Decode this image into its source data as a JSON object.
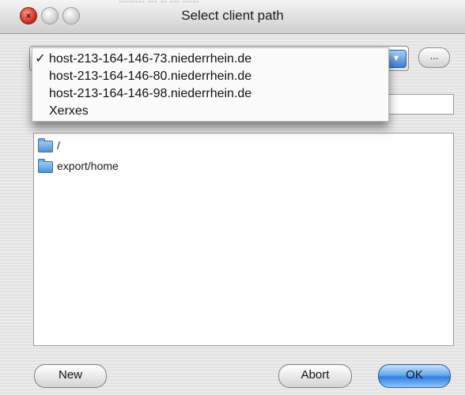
{
  "window": {
    "title": "Select client path",
    "ghost_text": "-------- --- -- --- -----"
  },
  "toolbar": {
    "browse_label": "..."
  },
  "host_menu": {
    "selected_index": 0,
    "items": [
      {
        "check": "✓",
        "label": "host-213-164-146-73.niederrhein.de"
      },
      {
        "check": "",
        "label": "host-213-164-146-80.niederrhein.de"
      },
      {
        "check": "",
        "label": "host-213-164-146-98.niederrhein.de"
      },
      {
        "check": "",
        "label": "Xerxes"
      }
    ]
  },
  "path_list": {
    "items": [
      {
        "icon": "folder-icon",
        "label": "/"
      },
      {
        "icon": "folder-icon",
        "label": "export/home"
      }
    ]
  },
  "buttons": {
    "new_label": "New",
    "abort_label": "Abort",
    "ok_label": "OK"
  },
  "colors": {
    "accent": "#3c7fd4",
    "close_button": "#c4231a"
  }
}
